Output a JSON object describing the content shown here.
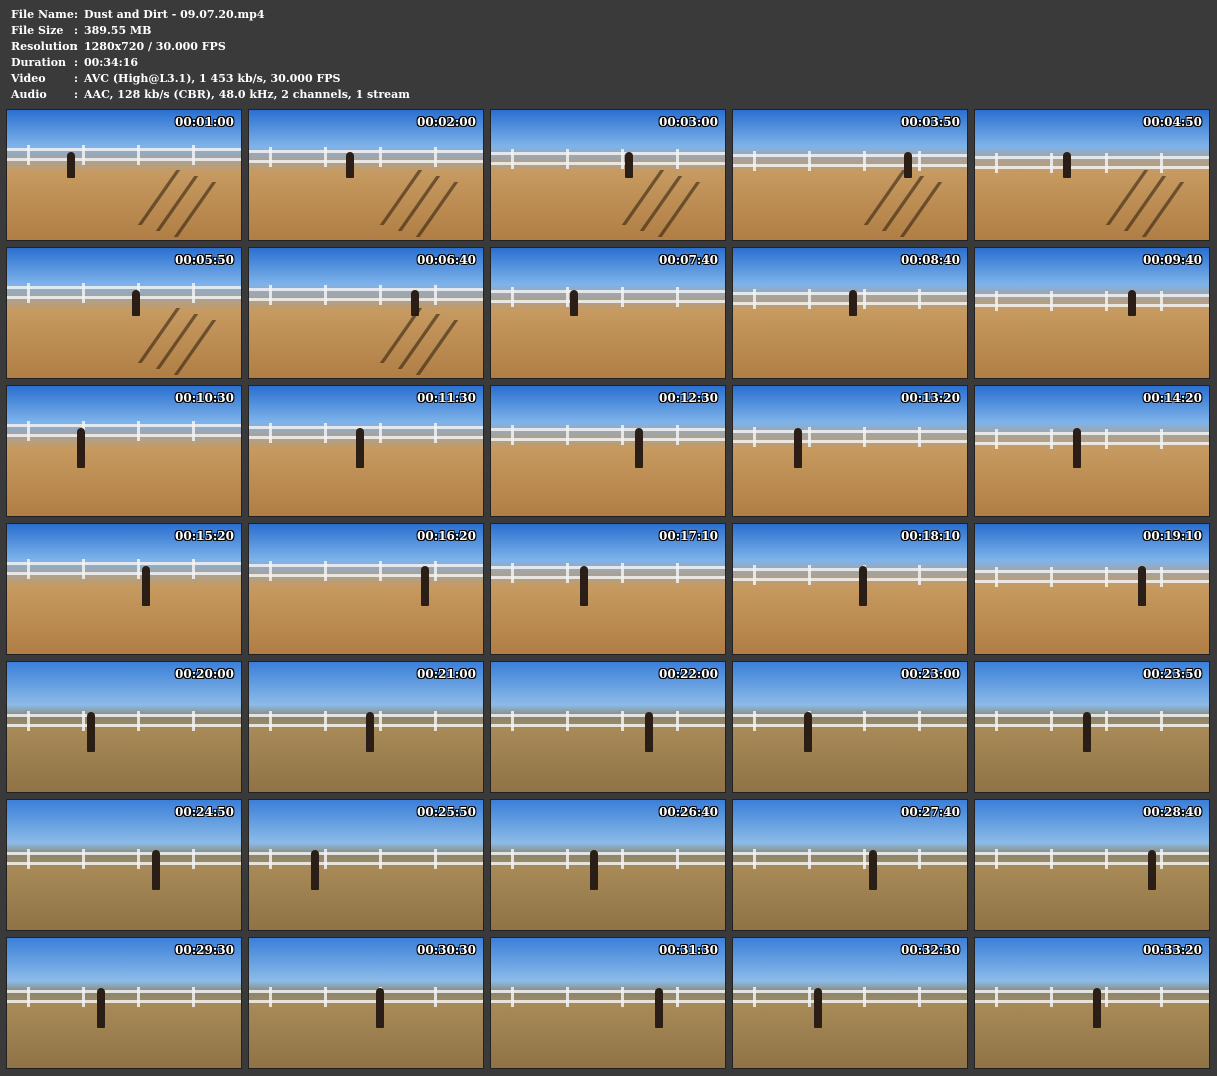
{
  "info": [
    {
      "key": "File Name",
      "sep": ":",
      "value": "Dust and Dirt - 09.07.20.mp4"
    },
    {
      "key": "File Size",
      "sep": ":",
      "value": "389.55 MB"
    },
    {
      "key": "Resolution",
      "sep": ":",
      "value": "1280x720 / 30.000 FPS"
    },
    {
      "key": "Duration",
      "sep": ":",
      "value": "00:34:16"
    },
    {
      "key": "Video",
      "sep": ":",
      "value": "AVC (High@L3.1), 1 453 kb/s, 30.000 FPS"
    },
    {
      "key": "Audio",
      "sep": ":",
      "value": "AAC, 128 kb/s (CBR), 48.0 kHz, 2 channels, 1 stream"
    }
  ],
  "thumbnails": [
    "00:01:00",
    "00:02:00",
    "00:03:00",
    "00:03:50",
    "00:04:50",
    "00:05:50",
    "00:06:40",
    "00:07:40",
    "00:08:40",
    "00:09:40",
    "00:10:30",
    "00:11:30",
    "00:12:30",
    "00:13:20",
    "00:14:20",
    "00:15:20",
    "00:16:20",
    "00:17:10",
    "00:18:10",
    "00:19:10",
    "00:20:00",
    "00:21:00",
    "00:22:00",
    "00:23:00",
    "00:23:50",
    "00:24:50",
    "00:25:50",
    "00:26:40",
    "00:27:40",
    "00:28:40",
    "00:29:30",
    "00:30:30",
    "00:31:30",
    "00:32:30",
    "00:33:20"
  ],
  "colors": {
    "background": "#3a3a3a",
    "text": "#ffffff"
  }
}
